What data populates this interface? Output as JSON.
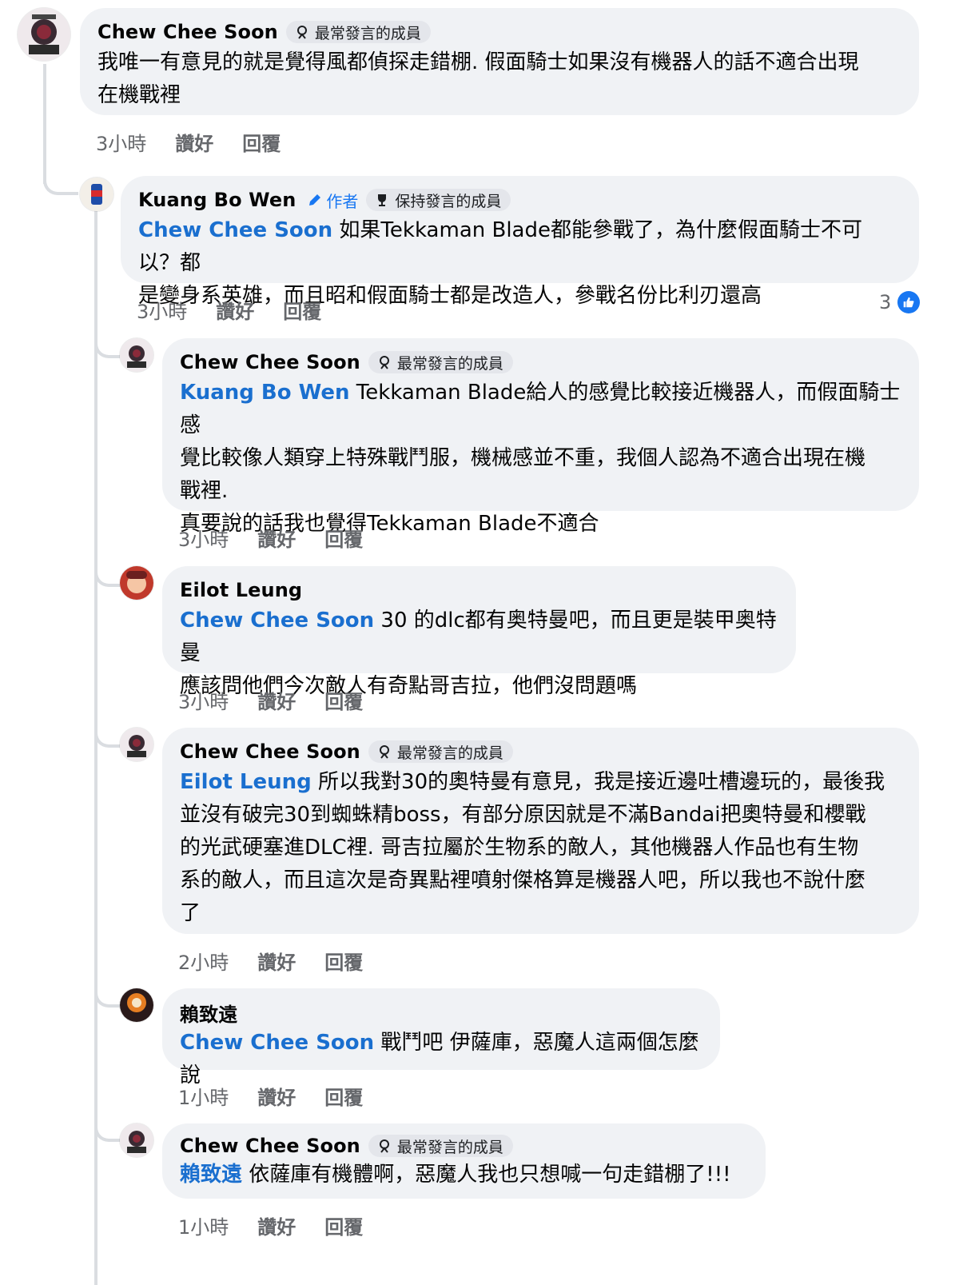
{
  "colors": {
    "bubble": "#f0f2f5",
    "mention": "#1a6fcf",
    "meta": "#65676b",
    "like_blue": "#1877f2"
  },
  "comments": [
    {
      "author": "Chew Chee Soon",
      "badge": "最常發言的成員",
      "badge_icon": "member-badge-icon",
      "line1": "我唯一有意見的就是覺得風都偵探走錯棚. 假面騎士如果沒有機器人的話不適合出現",
      "line2": "在機戰裡",
      "time": "3小時",
      "like": "讚好",
      "reply": "回覆"
    },
    {
      "author": "Kuang Bo Wen",
      "author_tag": "作者",
      "badge": "保持發言的成員",
      "badge_icon": "trophy-icon",
      "mention": "Chew Chee Soon",
      "line1": " 如果Tekkaman Blade都能參戰了，為什麼假面騎士不可以？都",
      "line2": "是變身系英雄，而且昭和假面騎士都是改造人，參戰名份比利刃還高",
      "time": "3小時",
      "like": "讚好",
      "reply": "回覆",
      "reaction_count": "3"
    },
    {
      "author": "Chew Chee Soon",
      "badge": "最常發言的成員",
      "mention": "Kuang Bo Wen",
      "line1": " Tekkaman Blade給人的感覺比較接近機器人，而假面騎士感",
      "line2": "覺比較像人類穿上特殊戰鬥服，機械感並不重，我個人認為不適合出現在機",
      "line3": "戰裡.",
      "line4": "真要說的話我也覺得Tekkaman Blade不適合",
      "time": "3小時",
      "like": "讚好",
      "reply": "回覆"
    },
    {
      "author": "Eilot Leung",
      "mention": "Chew Chee Soon",
      "line1": " 30 的dlc都有奥特曼吧，而且更是裝甲奥特曼",
      "line2": "應該問他們今次敵人有奇點哥吉拉，他們沒問題嗎",
      "time": "3小時",
      "like": "讚好",
      "reply": "回覆"
    },
    {
      "author": "Chew Chee Soon",
      "badge": "最常發言的成員",
      "mention": "Eilot Leung",
      "line1": " 所以我對30的奧特曼有意見，我是接近邊吐槽邊玩的，最後我",
      "line2": "並沒有破完30到蜘蛛精boss，有部分原因就是不滿Bandai把奧特曼和櫻戰",
      "line3": "的光武硬塞進DLC裡. 哥吉拉屬於生物系的敵人，其他機器人作品也有生物",
      "line4": "系的敵人，而且這次是奇異點裡噴射傑格算是機器人吧，所以我也不說什麼",
      "line5": "了",
      "time": "2小時",
      "like": "讚好",
      "reply": "回覆"
    },
    {
      "author": "賴致遠",
      "mention": "Chew Chee Soon",
      "line1": " 戰鬥吧 伊薩庫，惡魔人這兩個怎麼說",
      "time": "1小時",
      "like": "讚好",
      "reply": "回覆"
    },
    {
      "author": "Chew Chee Soon",
      "badge": "最常發言的成員",
      "mention": "賴致遠",
      "line1": " 依薩庫有機體啊，惡魔人我也只想喊一句走錯棚了!!!",
      "time": "1小時",
      "like": "讚好",
      "reply": "回覆"
    }
  ]
}
